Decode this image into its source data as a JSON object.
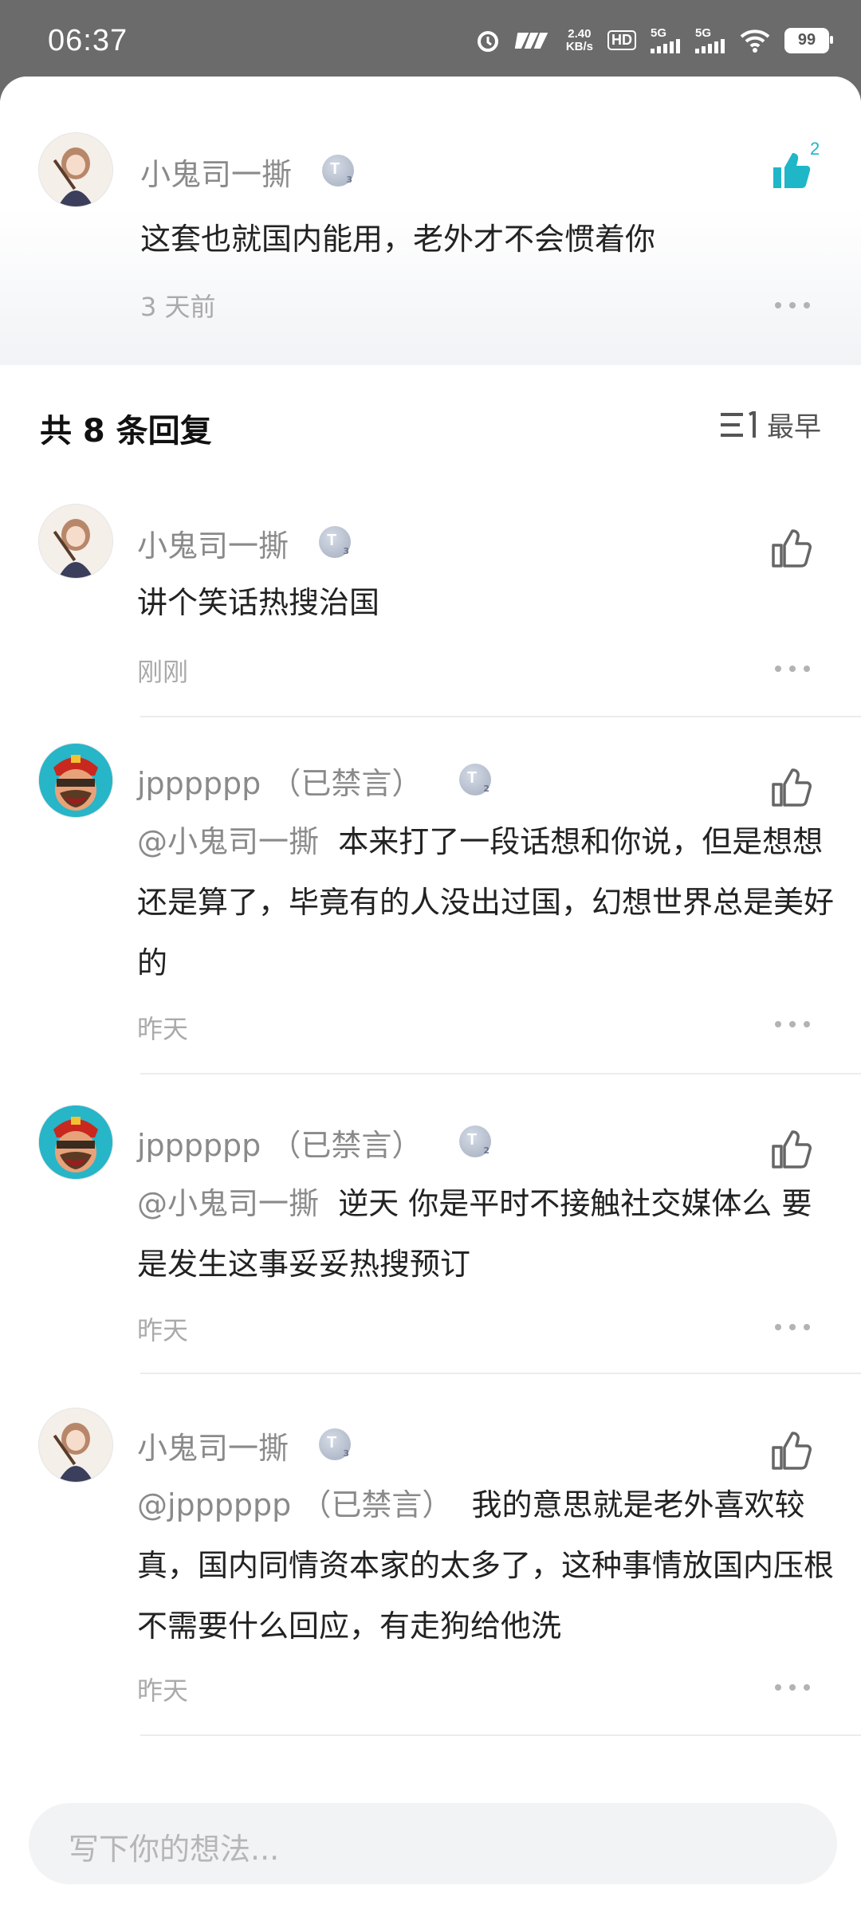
{
  "status_bar": {
    "time": "06:37",
    "speed_value": "2.40",
    "speed_unit": "KB/s",
    "hd": "HD",
    "sim1": "5G",
    "sim2": "5G",
    "battery": "99",
    "icons": [
      "alarm-icon",
      "nfc-icon",
      "hd-icon",
      "signal-icon",
      "signal-icon",
      "wifi-icon",
      "battery-icon"
    ]
  },
  "top_comment": {
    "user": "小鬼司一撕",
    "badge": "T",
    "text": "这套也就国内能用，老外才不会惯着你",
    "time": "3 天前",
    "likes": "2",
    "liked": true
  },
  "replies_header": {
    "title": "共 8 条回复",
    "sort_label": "最早"
  },
  "replies": [
    {
      "user": "小鬼司一撕",
      "mention": "",
      "text": "讲个笑话热搜治国",
      "time": "刚刚"
    },
    {
      "user": "jpppppp （已禁言）",
      "mention": "@小鬼司一撕",
      "text": "本来打了一段话想和你说，但是想想还是算了，毕竟有的人没出过国，幻想世界总是美好的",
      "time": "昨天"
    },
    {
      "user": "jpppppp （已禁言）",
      "mention": "@小鬼司一撕",
      "text": "逆天 你是平时不接触社交媒体么 要是发生这事妥妥热搜预订",
      "time": "昨天"
    },
    {
      "user": "小鬼司一撕",
      "mention": "@jpppppp （已禁言）",
      "text": "我的意思就是老外喜欢较真，国内同情资本家的太多了，这种事情放国内压根不需要什么回应，有走狗给他洗",
      "time": "昨天"
    }
  ],
  "composer": {
    "placeholder": "写下你的想法..."
  },
  "colors": {
    "accent": "#1fb6c8",
    "muted": "#8a8a8a"
  }
}
